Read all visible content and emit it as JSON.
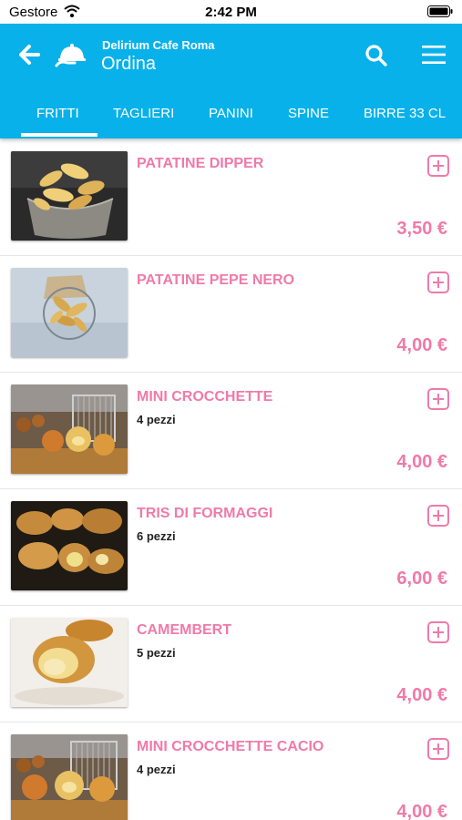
{
  "status_bar": {
    "carrier": "Gestore",
    "time": "2:42 PM"
  },
  "header": {
    "restaurant": "Delirium Cafe Roma",
    "title": "Ordina"
  },
  "tabs": [
    {
      "label": "FRITTI",
      "active": true
    },
    {
      "label": "TAGLIERI",
      "active": false
    },
    {
      "label": "PANINI",
      "active": false
    },
    {
      "label": "SPINE",
      "active": false
    },
    {
      "label": "BIRRE 33 CL",
      "active": false
    }
  ],
  "items": [
    {
      "name": "PATATINE DIPPER",
      "description": "",
      "price": "3,50 €"
    },
    {
      "name": "PATATINE PEPE NERO",
      "description": "",
      "price": "4,00 €"
    },
    {
      "name": "MINI CROCCHETTE",
      "description": "4 pezzi",
      "price": "4,00 €"
    },
    {
      "name": "TRIS DI FORMAGGI",
      "description": "6 pezzi",
      "price": "6,00 €"
    },
    {
      "name": "CAMEMBERT",
      "description": "5 pezzi",
      "price": "4,00 €"
    },
    {
      "name": "MINI CROCCHETTE CACIO",
      "description": "4 pezzi",
      "price": "4,00 €"
    }
  ],
  "colors": {
    "header": "#08b1e9",
    "accent": "#f07aa8"
  },
  "icons": [
    "back-arrow-icon",
    "cloche-logo-icon",
    "search-icon",
    "hamburger-menu-icon",
    "add-icon",
    "wifi-icon",
    "battery-icon"
  ]
}
